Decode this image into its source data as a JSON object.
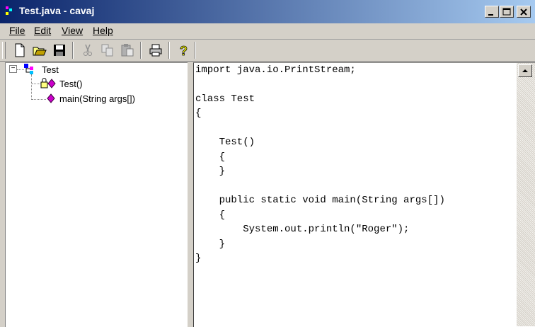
{
  "window": {
    "title": "Test.java - cavaj"
  },
  "menu": [
    "File",
    "Edit",
    "View",
    "Help"
  ],
  "toolbar": {
    "icons": [
      "new-file-icon",
      "open-folder-icon",
      "save-icon",
      "cut-icon",
      "copy-icon",
      "paste-icon",
      "print-icon",
      "help-icon"
    ]
  },
  "tree": {
    "root": {
      "label": "Test",
      "expander": "⊟"
    },
    "children": [
      {
        "label": "Test()"
      },
      {
        "label": "main(String args[])"
      }
    ]
  },
  "code": {
    "lines": [
      "import java.io.PrintStream;",
      "",
      "class Test",
      "{",
      "",
      "    Test()",
      "    {",
      "    }",
      "",
      "    public static void main(String args[])",
      "    {",
      "        System.out.println(\"Roger\");",
      "    }",
      "}"
    ]
  },
  "colors": {
    "title_start": "#0a246a",
    "title_end": "#a6caf0",
    "face": "#d4d0c8",
    "class_icon": "#0000ff",
    "method_icon": "#cc00cc"
  }
}
